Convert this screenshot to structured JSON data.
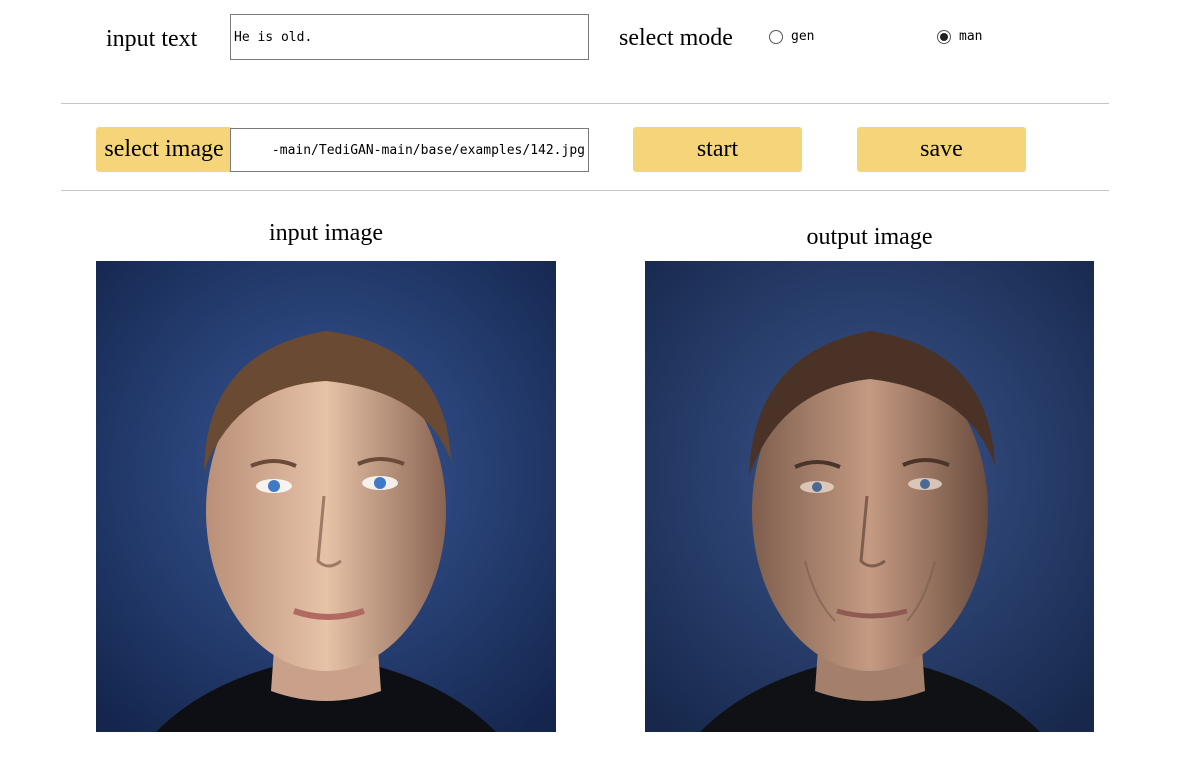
{
  "input_text": {
    "label": "input text",
    "value": "He is old."
  },
  "mode": {
    "label": "select mode",
    "options": [
      {
        "label": "gen",
        "selected": false
      },
      {
        "label": "man",
        "selected": true
      }
    ]
  },
  "image_select": {
    "button_label": "select image",
    "path": "-main/TediGAN-main/base/examples/142.jpg"
  },
  "actions": {
    "start_label": "start",
    "save_label": "save"
  },
  "panels": {
    "input_title": "input image",
    "output_title": "output image"
  },
  "colors": {
    "button_bg": "#f6d57a",
    "divider": "#c6c6c6",
    "photo_bg": "#23427a"
  }
}
